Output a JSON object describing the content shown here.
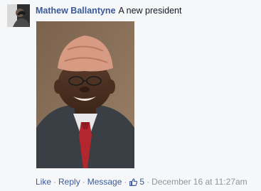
{
  "comment": {
    "author": "Mathew Ballantyne",
    "text": "A new president",
    "photo_icon": "photo",
    "avatar_icon": "avatar"
  },
  "actions": {
    "like_label": "Like",
    "reply_label": "Reply",
    "message_label": "Message",
    "separator": "·",
    "like_count": "5",
    "like_count_icon": "thumbs-up-icon",
    "timestamp": "December 16 at 11:27am"
  },
  "colors": {
    "link": "#3b5998",
    "meta": "#90949c",
    "background": "#f6f7f9"
  }
}
